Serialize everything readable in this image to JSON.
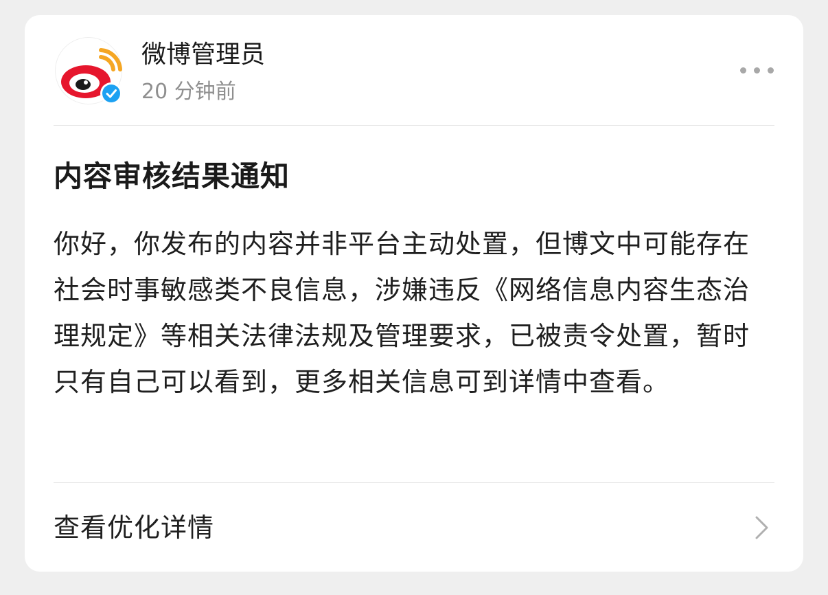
{
  "post": {
    "user_name": "微博管理员",
    "time": "20 分钟前",
    "verified": true,
    "avatar_icon": "weibo-logo-icon",
    "more_icon": "more-dots-icon"
  },
  "notice": {
    "title": "内容审核结果通知",
    "body": "你好，你发布的内容并非平台主动处置，但博文中可能存在社会时事敏感类不良信息，涉嫌违反《网络信息内容生态治理规定》等相关法律法规及管理要求，已被责令处置，暂时只有自己可以看到，更多相关信息可到详情中查看。"
  },
  "footer": {
    "detail_label": "查看优化详情",
    "chevron_icon": "chevron-right-icon"
  },
  "colors": {
    "background": "#efefef",
    "card": "#ffffff",
    "weibo_red": "#e6162d",
    "weibo_orange": "#f5a623",
    "verified_blue": "#1da1f2",
    "secondary_text": "#8f8f8f"
  }
}
